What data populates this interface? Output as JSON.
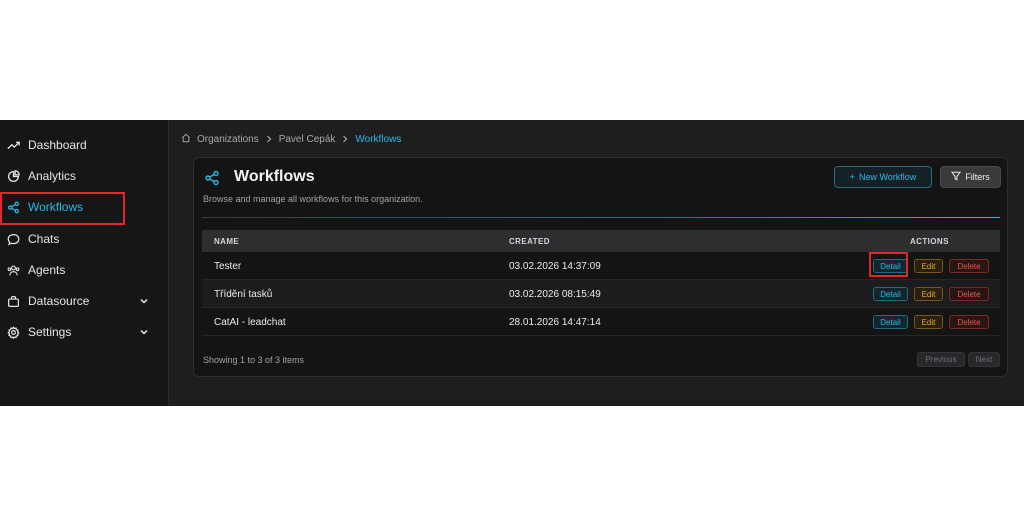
{
  "sidebar": {
    "items": [
      {
        "label": "Dashboard",
        "icon": "trending-up-icon"
      },
      {
        "label": "Analytics",
        "icon": "chart-icon"
      },
      {
        "label": "Workflows",
        "icon": "share-nodes-icon",
        "active": true
      },
      {
        "label": "Chats",
        "icon": "chat-bubble-icon"
      },
      {
        "label": "Agents",
        "icon": "users-icon"
      },
      {
        "label": "Datasource",
        "icon": "briefcase-icon",
        "expandable": true
      },
      {
        "label": "Settings",
        "icon": "gear-icon",
        "expandable": true
      }
    ]
  },
  "breadcrumb": {
    "items": [
      "Organizations",
      "Pavel Cepák",
      "Workflows"
    ]
  },
  "page": {
    "title": "Workflows",
    "subtitle": "Browse and manage all workflows for this organization.",
    "new_button": "New Workflow",
    "filters_button": "Filters"
  },
  "table": {
    "columns": [
      "NAME",
      "CREATED",
      "ACTIONS"
    ],
    "rows": [
      {
        "name": "Tester",
        "created": "03.02.2026 14:37:09"
      },
      {
        "name": "Třídění tasků",
        "created": "03.02.2026 08:15:49"
      },
      {
        "name": "CatAI - leadchat",
        "created": "28.01.2026 14:47:14"
      }
    ],
    "actions": {
      "detail": "Detail",
      "edit": "Edit",
      "delete": "Delete"
    }
  },
  "footer": {
    "showing": "Showing 1 to 3 of 3 items",
    "previous": "Previous",
    "next": "Next"
  },
  "colors": {
    "accent": "#2bb8e8",
    "edit": "#e9a53a",
    "delete": "#e05a4f",
    "highlight": "#e0282b"
  }
}
